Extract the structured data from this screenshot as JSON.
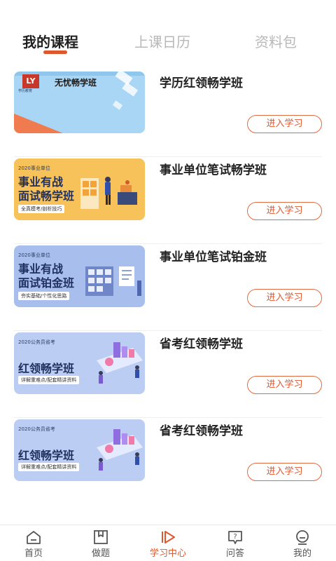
{
  "tabs": [
    {
      "label": "我的课程",
      "active": true
    },
    {
      "label": "上课日历",
      "active": false
    },
    {
      "label": "资料包",
      "active": false
    }
  ],
  "colors": {
    "accent": "#e0572e",
    "inactive_tab": "#b8b8b8",
    "thumb_blue": "#a9d6f5",
    "thumb_yellow": "#f7c25a",
    "thumb_periwinkle": "#a8bfee"
  },
  "courses": [
    {
      "title": "学历红领畅学班",
      "button": "进入学习",
      "thumb": {
        "brand": "学历教育",
        "big": "无忧畅学班",
        "icon": "logo-icon"
      }
    },
    {
      "title": "事业单位笔试畅学班",
      "button": "进入学习",
      "thumb": {
        "small": "2020事业单位",
        "line1": "事业有战",
        "line2": "面试畅学班",
        "tag": "全真模考/剖析技巧"
      }
    },
    {
      "title": "事业单位笔试铂金班",
      "button": "进入学习",
      "thumb": {
        "small": "2020事业单位",
        "line1": "事业有战",
        "line2": "面试铂金班",
        "tag": "夯实基础/个性化思路"
      }
    },
    {
      "title": "省考红领畅学班",
      "button": "进入学习",
      "thumb": {
        "small": "2020公务员省考",
        "line1": "红领畅学班",
        "tag": "详解重难点/配套精讲资料"
      }
    },
    {
      "title": "省考红领畅学班",
      "button": "进入学习",
      "thumb": {
        "small": "2020公务员省考",
        "line1": "红领畅学班",
        "tag": "详解重难点/配套精讲资料"
      }
    }
  ],
  "bottom_nav": [
    {
      "label": "首页",
      "icon": "home-icon",
      "active": false
    },
    {
      "label": "做题",
      "icon": "practice-icon",
      "active": false
    },
    {
      "label": "学习中心",
      "icon": "play-icon",
      "active": true
    },
    {
      "label": "问答",
      "icon": "qa-icon",
      "active": false
    },
    {
      "label": "我的",
      "icon": "profile-icon",
      "active": false
    }
  ]
}
